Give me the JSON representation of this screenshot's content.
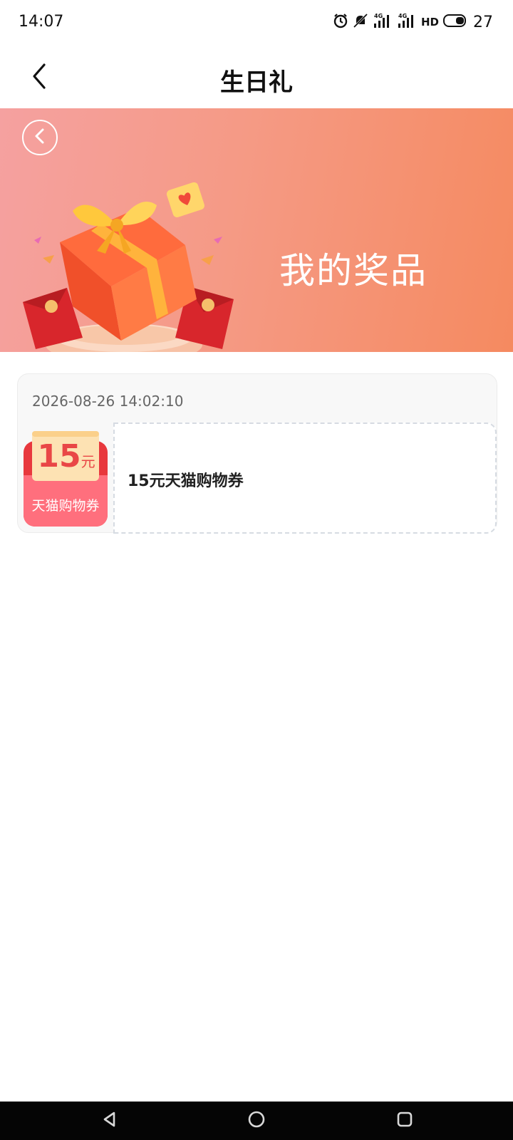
{
  "status_bar": {
    "time": "14:07",
    "network_label": "4G",
    "hd_label": "HD",
    "battery_level": "27",
    "icons": [
      "alarm-icon",
      "mute-icon",
      "signal-icon",
      "signal-icon",
      "battery-icon"
    ]
  },
  "nav": {
    "title": "生日礼",
    "back_icon": "chevron-left-icon"
  },
  "banner": {
    "title": "我的奖品",
    "back_icon": "circle-chevron-left-icon",
    "colors": {
      "start": "#f5a1a0",
      "end": "#f58a60"
    }
  },
  "prizes": [
    {
      "date": "2026-08-26 14:02:10",
      "coupon_amount": "15",
      "coupon_unit": "元",
      "coupon_label": "天猫购物券",
      "name": "15元天猫购物券"
    }
  ],
  "system_nav": {
    "buttons": [
      "back-triangle-icon",
      "home-circle-icon",
      "recents-square-icon"
    ]
  }
}
